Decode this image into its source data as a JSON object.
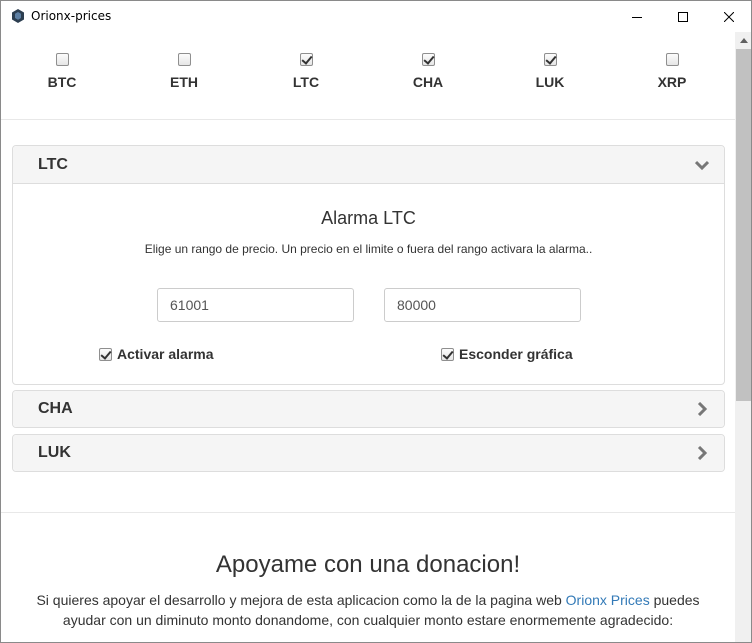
{
  "window": {
    "title": "Orionx-prices"
  },
  "coins": [
    {
      "label": "BTC",
      "checked": false
    },
    {
      "label": "ETH",
      "checked": false
    },
    {
      "label": "LTC",
      "checked": true
    },
    {
      "label": "CHA",
      "checked": true
    },
    {
      "label": "LUK",
      "checked": true
    },
    {
      "label": "XRP",
      "checked": false
    }
  ],
  "panels": {
    "ltc": {
      "title": "LTC",
      "expanded": true,
      "alarm_title": "Alarma LTC",
      "alarm_desc": "Elige un rango de precio. Un precio en el limite o fuera del rango activara la alarma..",
      "min_value": "61001",
      "max_value": "80000",
      "activate_label": "Activar alarma",
      "activate_checked": true,
      "hide_label": "Esconder gráfica",
      "hide_checked": true
    },
    "cha": {
      "title": "CHA",
      "expanded": false
    },
    "luk": {
      "title": "LUK",
      "expanded": false
    }
  },
  "donation": {
    "title": "Apoyame con una donacion!",
    "text_before": "Si quieres apoyar el desarrollo y mejora de esta aplicacion como la de la pagina web ",
    "link_text": "Orionx Prices",
    "text_after": " puedes ayudar con un diminuto monto donandome, con cualquier monto estare enormemente agradecido:"
  },
  "colors": {
    "link": "#337ab7",
    "panel_header": "#f5f5f5",
    "border": "#dddddd"
  }
}
